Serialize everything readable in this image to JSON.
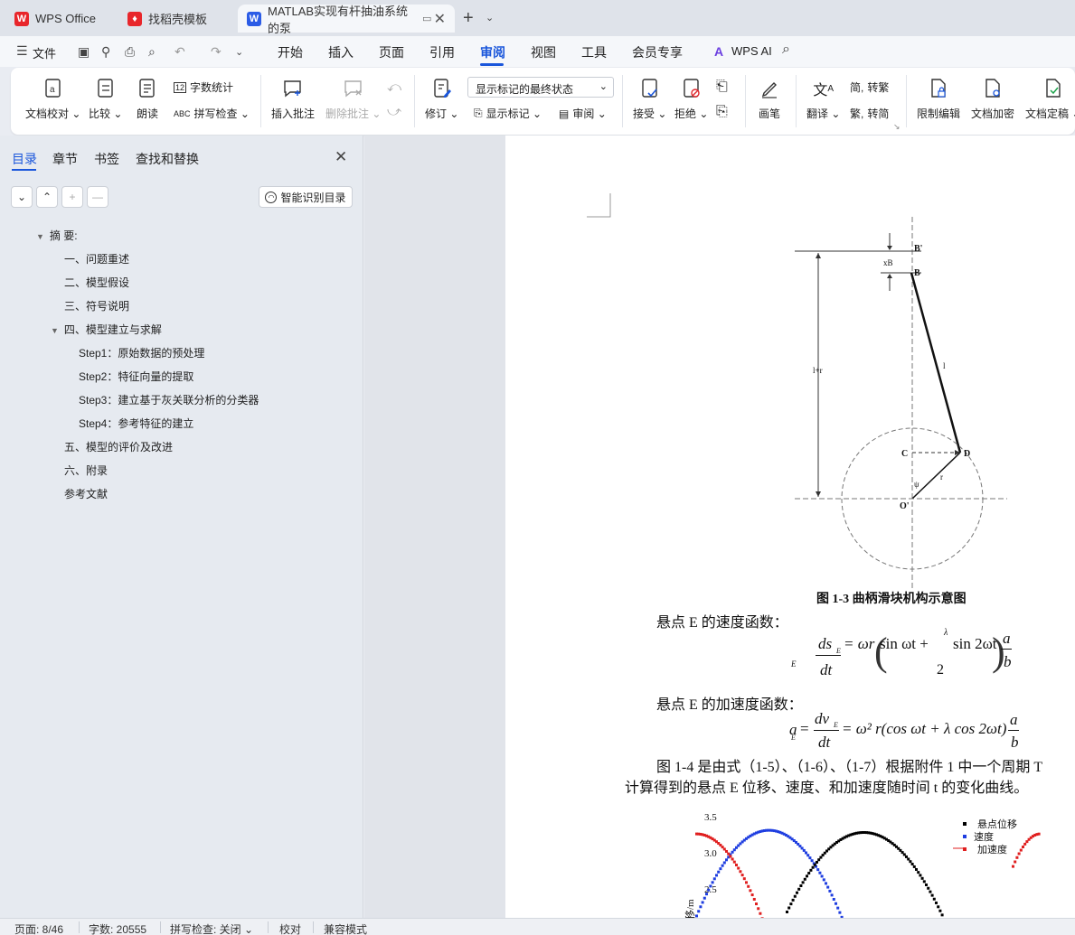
{
  "tabs": [
    {
      "label": "WPS Office",
      "logo_color": "#e8262b"
    },
    {
      "label": "找稻壳模板",
      "logo_color": "#e8262b"
    },
    {
      "label": "MATLAB实现有杆抽油系统的泵",
      "logo_color": "#2b5ce6",
      "active": true
    }
  ],
  "menu": {
    "file": "文件",
    "items": [
      "开始",
      "插入",
      "页面",
      "引用",
      "审阅",
      "视图",
      "工具",
      "会员专享"
    ],
    "active": "审阅",
    "wps_ai": "WPS AI"
  },
  "ribbon": {
    "proofread": "文档校对",
    "compare": "比较",
    "read_aloud": "朗读",
    "word_count": "字数统计",
    "spell_check": "拼写检查",
    "insert_comment": "插入批注",
    "delete_comment": "删除批注",
    "revise": "修订",
    "markup_state": "显示标记的最终状态",
    "show_markup": "显示标记",
    "review": "审阅",
    "accept": "接受",
    "reject": "拒绝",
    "pen": "画笔",
    "translate": "翻译",
    "to_traditional": "转繁",
    "to_simplified": "转简",
    "restrict_edit": "限制编辑",
    "doc_encrypt": "文档加密",
    "doc_finalize": "文档定稿"
  },
  "leftpanel": {
    "tabs": [
      "目录",
      "章节",
      "书签",
      "查找和替换"
    ],
    "ai_toc": "智能识别目录",
    "toc": [
      {
        "text": "摘  要:",
        "level": 0,
        "collapsible": true
      },
      {
        "text": "一、问题重述",
        "level": 1
      },
      {
        "text": "二、模型假设",
        "level": 1
      },
      {
        "text": "三、符号说明",
        "level": 1
      },
      {
        "text": "四、模型建立与求解",
        "level": 1,
        "collapsible": true
      },
      {
        "text": "Step1：原始数据的预处理",
        "level": 2
      },
      {
        "text": "Step2：特征向量的提取",
        "level": 2
      },
      {
        "text": "Step3：建立基于灰关联分析的分类器",
        "level": 2
      },
      {
        "text": "Step4：参考特征的建立",
        "level": 2
      },
      {
        "text": "五、模型的评价及改进",
        "level": 1
      },
      {
        "text": "六、附录",
        "level": 1
      },
      {
        "text": "参考文献",
        "level": 1
      }
    ]
  },
  "document": {
    "diagram_labels": {
      "B_prime": "B'",
      "B": "B",
      "xB": "xB",
      "l": "l",
      "lr": "l+r",
      "C": "C",
      "D": "D",
      "r": "r",
      "O": "O'",
      "psi": "ψ"
    },
    "figure_caption": "图 1-3 曲柄滑块机构示意图",
    "velocity_intro": "悬点 E 的速度函数：",
    "accel_intro": "悬点  E 的加速度函数：",
    "para1_line1": "图 1-4 是由式（1-5）、（1-6）、（1-7）根据附件  1 中一个周期  T",
    "para1_line2": "计算得到的悬点  E 位移、速度、和加速度随时间  t 的变化曲线。",
    "eq_vel": {
      "lhs_num": "ds",
      "lhs_sub": "E",
      "lhs_den": "dt",
      "rhs": "= ωr",
      "t1": "sin ωt +",
      "lam": "λ",
      "t2": "sin 2ωt",
      "two": "2",
      "a": "a",
      "b": "b",
      "side": "E"
    },
    "eq_acc": {
      "lhs": "a",
      "sub": "E",
      "mid": "=",
      "num": "dv",
      "num_sub": "E",
      "den": "dt",
      "rhs": "= ω² r(cos ωt + λ cos 2ωt)",
      "a": "a",
      "b": "b"
    }
  },
  "chart_data": {
    "type": "scatter",
    "yticks": [
      "3.5",
      "3.0",
      "2.5"
    ],
    "ylabel": "移/m",
    "legend": [
      "悬点位移",
      "速度",
      "加速度"
    ],
    "series_colors": [
      "#000000",
      "#1f3ee0",
      "#e01f1f"
    ],
    "legend_position": "top-right"
  },
  "status": {
    "page": "页面: 8/46",
    "words": "字数: 20555",
    "spell": "拼写检查: 关闭",
    "proof": "校对",
    "compat": "兼容模式"
  }
}
